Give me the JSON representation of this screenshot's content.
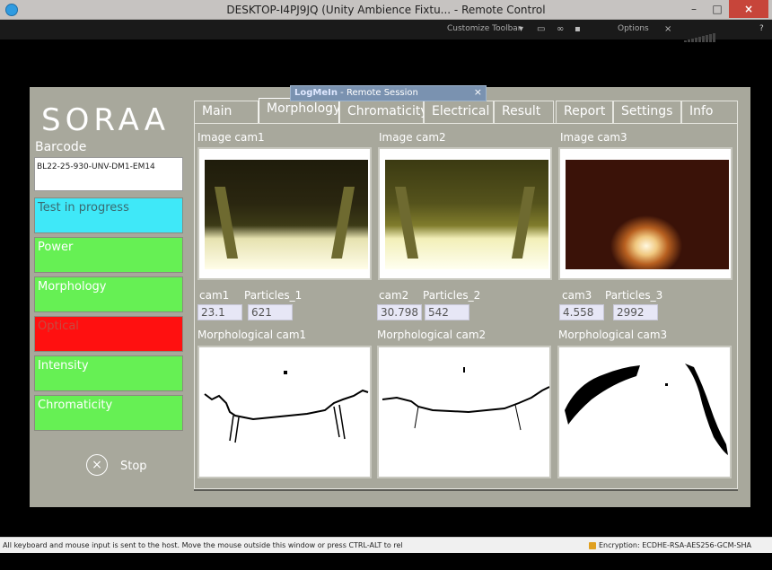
{
  "window": {
    "title": "DESKTOP-I4PJ9JQ (Unity Ambience Fixtu... - Remote Control",
    "min_label": "–",
    "max_label": "□",
    "close_label": "×"
  },
  "toolbar": {
    "customize_label": "Customize Toolbar",
    "options_label": "Options",
    "help_label": "?"
  },
  "overlay": {
    "brand": "LogMeIn",
    "text": " - Remote Session",
    "close": "×"
  },
  "app": {
    "logo": "SORAA",
    "barcode_label": "Barcode",
    "barcode_value": "BL22-25-930-UNV-DM1-EM14",
    "statuses": [
      {
        "label": "Test in progress",
        "color": "cyan"
      },
      {
        "label": "Power",
        "color": "green"
      },
      {
        "label": "Morphology",
        "color": "green"
      },
      {
        "label": "Optical",
        "color": "red"
      },
      {
        "label": "Intensity",
        "color": "green"
      },
      {
        "label": "Chromaticity",
        "color": "green"
      }
    ],
    "stop_label": "Stop"
  },
  "tabs": [
    "Main",
    "Morphology",
    "Chromaticity",
    "Electrical",
    "Result",
    "Report",
    "Settings",
    "Info"
  ],
  "active_tab": "Morphology",
  "cameras": [
    {
      "image_label": "Image cam1",
      "cam_label": "cam1",
      "particles_label": "Particles_1",
      "cam_value": "23.1",
      "particles_value": "621",
      "morph_label": "Morphological cam1"
    },
    {
      "image_label": "Image cam2",
      "cam_label": "cam2",
      "particles_label": "Particles_2",
      "cam_value": "30.798",
      "particles_value": "542",
      "morph_label": "Morphological cam2"
    },
    {
      "image_label": "Image cam3",
      "cam_label": "cam3",
      "particles_label": "Particles_3",
      "cam_value": "4.558",
      "particles_value": "2992",
      "morph_label": "Morphological cam3"
    }
  ],
  "statusbar": {
    "left": "All keyboard and mouse input is sent to the host. Move the mouse outside this window or press CTRL-ALT to rel",
    "right": "Encryption: ECDHE-RSA-AES256-GCM-SHA"
  }
}
